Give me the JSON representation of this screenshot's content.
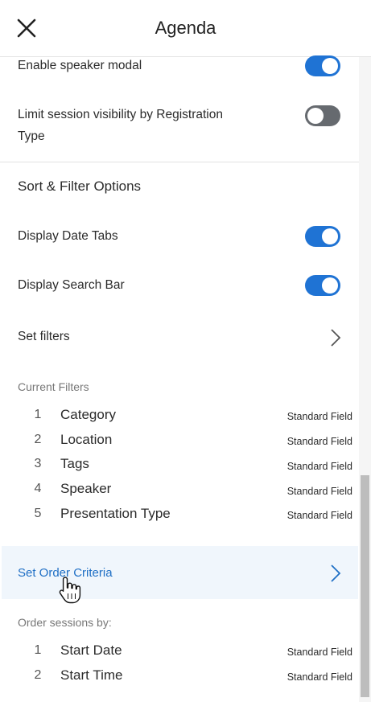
{
  "header": {
    "title": "Agenda",
    "close_icon": "close-icon"
  },
  "settings": {
    "enable_speaker_modal": {
      "label": "Enable speaker modal",
      "enabled": true
    },
    "limit_session_visibility": {
      "label_line1": "Limit session visibility by Registration",
      "label_line2": "Type",
      "enabled": false
    }
  },
  "sort_filter": {
    "title": "Sort & Filter Options",
    "display_date_tabs": {
      "label": "Display Date Tabs",
      "enabled": true
    },
    "display_search_bar": {
      "label": "Display Search Bar",
      "enabled": true
    },
    "set_filters": {
      "label": "Set filters"
    }
  },
  "current_filters": {
    "label": "Current Filters",
    "items": [
      {
        "num": "1",
        "name": "Category",
        "type": "Standard Field"
      },
      {
        "num": "2",
        "name": "Location",
        "type": "Standard Field"
      },
      {
        "num": "3",
        "name": "Tags",
        "type": "Standard Field"
      },
      {
        "num": "4",
        "name": "Speaker",
        "type": "Standard Field"
      },
      {
        "num": "5",
        "name": "Presentation Type",
        "type": "Standard Field"
      }
    ]
  },
  "order": {
    "set_order_label": "Set Order Criteria",
    "order_by_label": "Order sessions by:",
    "items": [
      {
        "num": "1",
        "name": "Start Date",
        "type": "Standard Field"
      },
      {
        "num": "2",
        "name": "Start Time",
        "type": "Standard Field"
      }
    ]
  },
  "colors": {
    "accent": "#1f73d4",
    "toggle_off": "#666a6f",
    "link": "#1f6fc5",
    "highlight": "#f0f6fc"
  }
}
